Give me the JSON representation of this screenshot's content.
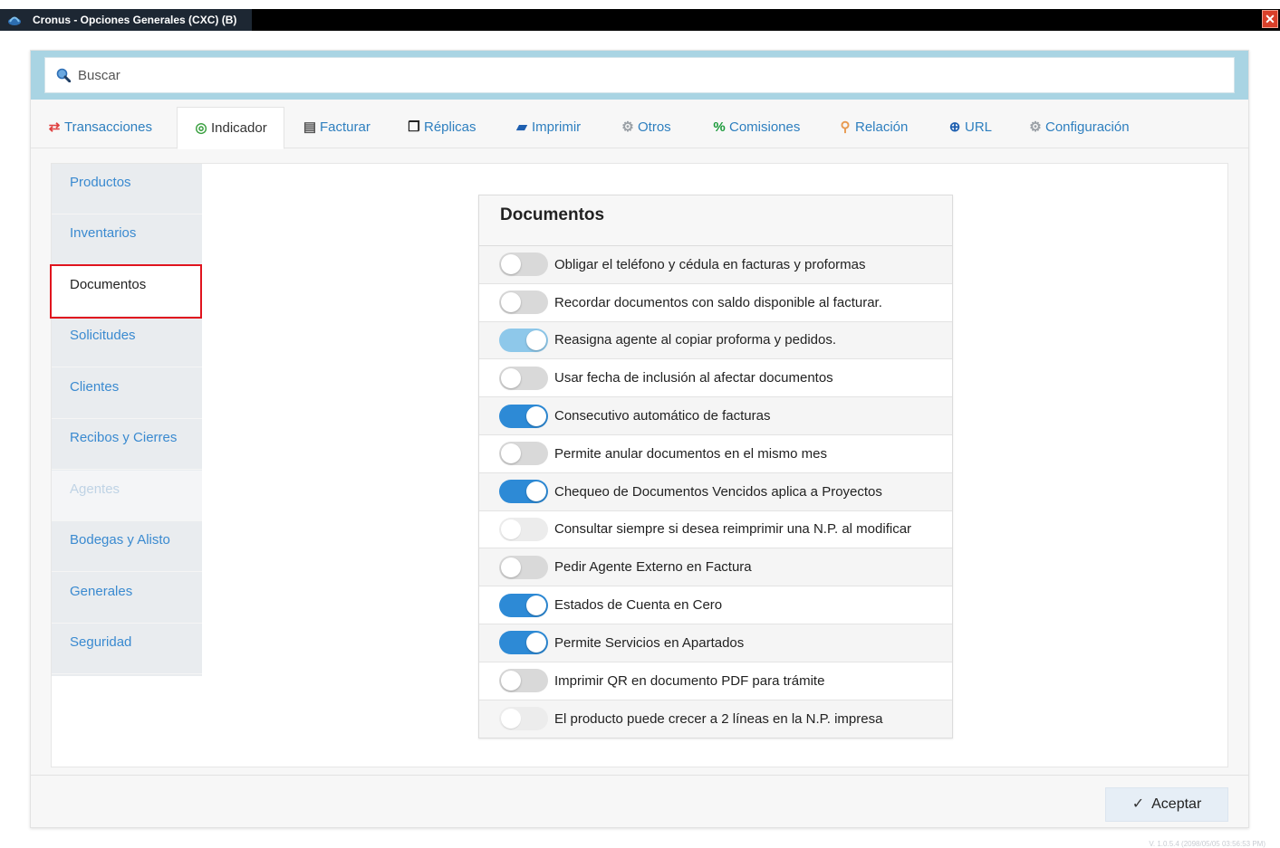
{
  "window": {
    "title": "Cronus - Opciones Generales (CXC) (B)",
    "close_glyph": "✕"
  },
  "search": {
    "placeholder": "Buscar"
  },
  "tabs": [
    {
      "label": "Transacciones",
      "icon": "⇄",
      "color": "#e04040"
    },
    {
      "label": "Indicador",
      "icon": "◎",
      "color": "#3aa040"
    },
    {
      "label": "Facturar",
      "icon": "▤",
      "color": "#555555"
    },
    {
      "label": "Réplicas",
      "icon": "❐",
      "color": "#222222"
    },
    {
      "label": "Imprimir",
      "icon": "▰",
      "color": "#1e5fb0"
    },
    {
      "label": "Otros",
      "icon": "⚙",
      "color": "#9aa0a6"
    },
    {
      "label": "Comisiones",
      "icon": "%",
      "color": "#1a9a3a"
    },
    {
      "label": "Relación",
      "icon": "⚲",
      "color": "#e89a50"
    },
    {
      "label": "URL",
      "icon": "⊕",
      "color": "#1e5fb0"
    },
    {
      "label": "Configuración",
      "icon": "⚙",
      "color": "#9aa0a6"
    }
  ],
  "sidebar": {
    "items": [
      {
        "label": "Productos",
        "state": "normal"
      },
      {
        "label": "Inventarios",
        "state": "normal"
      },
      {
        "label": "Documentos",
        "state": "selected"
      },
      {
        "label": "Solicitudes",
        "state": "normal"
      },
      {
        "label": "Clientes",
        "state": "normal"
      },
      {
        "label": "Recibos y Cierres",
        "state": "normal"
      },
      {
        "label": "Agentes",
        "state": "disabled"
      },
      {
        "label": "Bodegas y Alisto",
        "state": "normal"
      },
      {
        "label": "Generales",
        "state": "normal"
      },
      {
        "label": "Seguridad",
        "state": "normal"
      }
    ]
  },
  "panel": {
    "title": "Documentos",
    "options": [
      {
        "label": "Obligar el teléfono y cédula en facturas y proformas",
        "state": "off"
      },
      {
        "label": "Recordar documentos con saldo disponible al facturar.",
        "state": "off"
      },
      {
        "label": "Reasigna agente al copiar proforma y pedidos.",
        "state": "on-light"
      },
      {
        "label": "Usar fecha de inclusión al afectar documentos",
        "state": "off"
      },
      {
        "label": "Consecutivo automático de facturas",
        "state": "on"
      },
      {
        "label": "Permite anular documentos en el mismo mes",
        "state": "off"
      },
      {
        "label": "Chequeo de Documentos Vencidos aplica a Proyectos",
        "state": "on"
      },
      {
        "label": "Consultar siempre si desea reimprimir una N.P. al modificar",
        "state": "disabled"
      },
      {
        "label": "Pedir Agente Externo en Factura",
        "state": "off"
      },
      {
        "label": "Estados de Cuenta en Cero",
        "state": "on"
      },
      {
        "label": "Permite Servicios en Apartados",
        "state": "on"
      },
      {
        "label": "Imprimir QR en documento PDF para trámite",
        "state": "off"
      },
      {
        "label": "El producto puede crecer a 2 líneas en la N.P. impresa",
        "state": "disabled"
      }
    ]
  },
  "footer": {
    "accept_label": "Aceptar",
    "check_glyph": "✓",
    "version": "V. 1.0.5.4 (2098/05/05 03:56:53 PM)"
  }
}
